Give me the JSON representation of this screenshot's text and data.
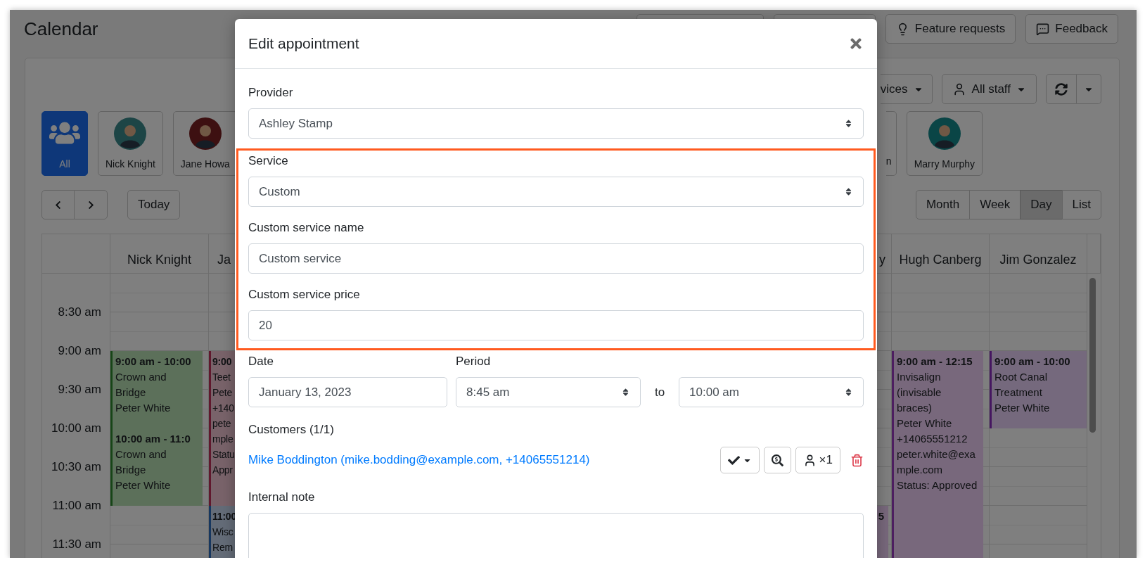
{
  "page": {
    "title": "Calendar"
  },
  "header_buttons": [
    {
      "kind": "blank"
    },
    {
      "kind": "blank"
    },
    {
      "kind": "idea",
      "label": "Feature requests"
    },
    {
      "kind": "chat",
      "label": "Feedback"
    }
  ],
  "filters": [
    {
      "kind": "cut",
      "label": "vices"
    },
    {
      "kind": "staff",
      "label": "All staff"
    }
  ],
  "staff_left": [
    {
      "kind": "group",
      "name": "All",
      "selected": true
    },
    {
      "kind": "avatar",
      "name": "Nick Knight",
      "selected": false,
      "color": "#1d4546"
    },
    {
      "kind": "avatar",
      "name": "Jane Howa",
      "selected": false,
      "color": "#3d1011"
    }
  ],
  "staff_right": [
    {
      "kind": "cut",
      "name": "n",
      "selected": false
    },
    {
      "kind": "avatar",
      "name": "Marry Murphy",
      "selected": false,
      "color": "#0a4546"
    }
  ],
  "nav": {
    "today": "Today"
  },
  "views": [
    {
      "label": "Month",
      "selected": false
    },
    {
      "label": "Week",
      "selected": false
    },
    {
      "label": "Day",
      "selected": true
    },
    {
      "label": "List",
      "selected": false
    }
  ],
  "calendar": {
    "times": [
      "8:30 am",
      "9:00 am",
      "9:30 am",
      "10:00 am",
      "10:30 am",
      "11:00 am",
      "11:30 am"
    ],
    "columns": [
      {
        "name": "Nick Knight",
        "events": [
          {
            "time": "9:00 am - 10:00",
            "lines": [
              "Crown and Bridge",
              "Peter White"
            ],
            "color": "#5c705a"
          },
          {
            "time": "10:00 am - 11:0",
            "lines": [
              "Crown and Bridge",
              "Peter White"
            ],
            "color": "#5c705a"
          }
        ]
      },
      {
        "name": "Ja",
        "events": [
          {
            "time": "9:00",
            "lines": [
              "Teet",
              "Pete",
              "+140",
              "pete",
              "mple",
              "Statu",
              "Appr"
            ],
            "color": "#79636a"
          },
          {
            "time": "11:00",
            "lines": [
              "Wisc",
              "Rem"
            ],
            "color": "#646c78"
          }
        ]
      },
      {
        "name": "y",
        "events": [
          {
            "time": "5",
            "color": "#78687c"
          }
        ]
      },
      {
        "name": "Hugh Canberg",
        "events": [
          {
            "time": "9:00 am - 12:15",
            "lines": [
              "Invisalign (invisable braces)",
              "Peter White",
              "+14065551212",
              "peter.white@example.com",
              "Status: Approved"
            ],
            "color": "#78687c"
          }
        ]
      },
      {
        "name": "Jim Gonzalez",
        "events": [
          {
            "time": "9:00 am - 10:00",
            "lines": [
              "Root Canal Treatment",
              "Peter White"
            ],
            "color": "#75697d"
          }
        ]
      }
    ]
  },
  "modal": {
    "title": "Edit appointment",
    "provider": {
      "label": "Provider",
      "value": "Ashley Stamp"
    },
    "highlighted": [
      {
        "kind": "select",
        "label": "Service",
        "value": "Custom"
      },
      {
        "kind": "input",
        "label": "Custom service name",
        "value": "Custom service"
      },
      {
        "kind": "input",
        "label": "Custom service price",
        "value": "20"
      }
    ],
    "date": {
      "label": "Date",
      "value": "January 13, 2023"
    },
    "period": {
      "label": "Period",
      "from": "8:45 am",
      "separator": "to",
      "to": "10:00 am"
    },
    "customers": {
      "label": "Customers (1/1)",
      "items": [
        {
          "name": "Mike Boddington (mike.bodding@example.com, +14065551214)",
          "capacity": "×1"
        }
      ]
    },
    "note": {
      "label": "Internal note"
    }
  }
}
